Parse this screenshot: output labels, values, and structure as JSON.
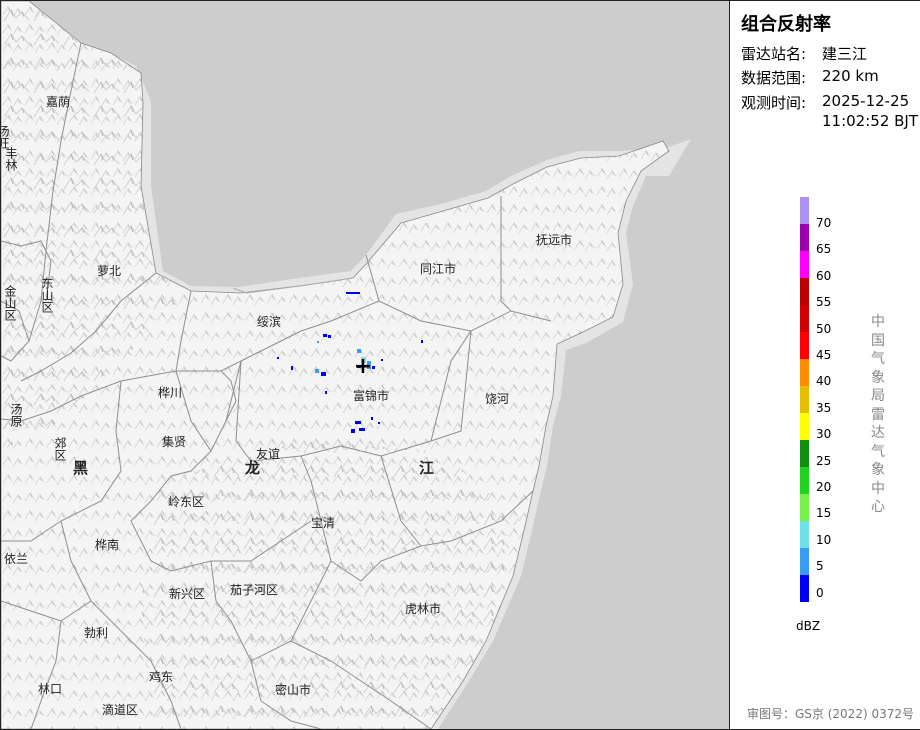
{
  "panel": {
    "title": "组合反射率",
    "station_label": "雷达站名:",
    "station_value": "建三江",
    "range_label": "数据范围:",
    "range_value": "220 km",
    "time_label": "观测时间:",
    "time_date": "2025-12-25",
    "time_clock": "11:02:52 BJT",
    "unit": "dBZ",
    "agency": "中国气象局雷达气象中心",
    "footer": "审图号：GS京 (2022) 0372号"
  },
  "legend": {
    "ticks": [
      "70",
      "65",
      "60",
      "55",
      "50",
      "45",
      "40",
      "35",
      "30",
      "25",
      "20",
      "15",
      "10",
      "5",
      "0"
    ],
    "colors": [
      "#0000f6",
      "#3a9bf2",
      "#6ee0e8",
      "#78f04c",
      "#1ed41e",
      "#10900e",
      "#ffff00",
      "#e6c000",
      "#ff8c00",
      "#ff0000",
      "#d40000",
      "#c00000",
      "#ff00ff",
      "#9c00ac",
      "#ad90f0"
    ]
  },
  "map": {
    "places": [
      "嘉荫",
      "汤旺",
      "丰林",
      "萝北",
      "东山区",
      "金山区",
      "绥滨",
      "同江市",
      "抚远市",
      "桦川",
      "富锦市",
      "饶河",
      "汤原",
      "郊区",
      "集贤",
      "友谊",
      "黑",
      "龙",
      "江",
      "岭东区",
      "宝清",
      "依兰",
      "桦南",
      "新兴区",
      "茄子河区",
      "虎林市",
      "勃利",
      "林口",
      "鸡东",
      "滴道区",
      "密山市"
    ],
    "radar_symbol": "+"
  }
}
